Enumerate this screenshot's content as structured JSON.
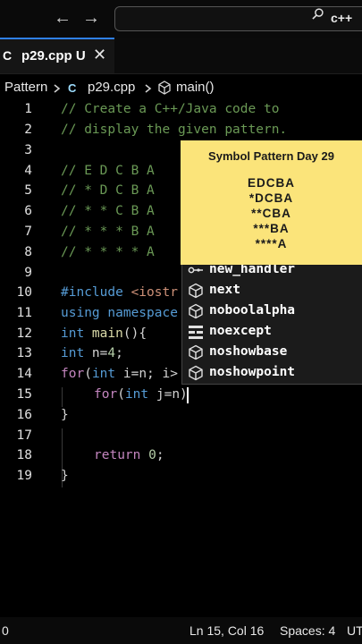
{
  "titlebar": {
    "back": "←",
    "forward": "→",
    "search_text": "c++"
  },
  "tab": {
    "icon_text": "C",
    "name": "p29.cpp U",
    "close": "✕"
  },
  "breadcrumb": {
    "folder": "Pattern",
    "file": "p29.cpp",
    "symbol": "main()"
  },
  "lines": [
    "1",
    "2",
    "3",
    "4",
    "5",
    "6",
    "7",
    "8",
    "9",
    "10",
    "11",
    "12",
    "13",
    "14",
    "15",
    "16",
    "17",
    "18",
    "19"
  ],
  "code": {
    "l1": "// Create a C++/Java code to",
    "l2": "// display the given pattern.",
    "l4": "// E D C B A",
    "l5": "// * D C B A",
    "l6": "// * * C B A",
    "l7": "// * * * B A",
    "l8": "// * * * * A",
    "l10a": "#include",
    "l10b": " <iostr",
    "l11a": "using",
    "l11b": " namespace",
    "l12a": "int",
    "l12b": " main",
    "l12c": "(){",
    "l13a": "int",
    "l13b": " n=",
    "l13c": "4",
    "l13d": ";",
    "l14a": "for",
    "l14b": "(",
    "l14c": "int",
    "l14d": " i=n; i>",
    "l15a": "for",
    "l15b": "(",
    "l15c": "int",
    "l15d": " j=n)",
    "l16": "}",
    "l18a": "return",
    "l18b": " ",
    "l18c": "0",
    "l18d": ";",
    "l19": "}"
  },
  "suggestions": [
    {
      "icon": "variable-icon",
      "text": "new_handler"
    },
    {
      "icon": "cube-icon",
      "text": "next"
    },
    {
      "icon": "cube-icon",
      "text": "noboolalpha"
    },
    {
      "icon": "keyword-icon",
      "text": "noexcept"
    },
    {
      "icon": "cube-icon",
      "text": "noshowbase"
    },
    {
      "icon": "cube-icon",
      "text": "noshowpoint"
    }
  ],
  "overlay": {
    "title": "Symbol Pattern Day 29",
    "rows": [
      "EDCBA",
      "*DCBA",
      "**CBA",
      "***BA",
      "****A"
    ],
    "bg_color": "#fbe47a"
  },
  "status": {
    "left": "0",
    "position": "Ln 15, Col 16",
    "spaces": "Spaces: 4",
    "encoding": "UT"
  }
}
